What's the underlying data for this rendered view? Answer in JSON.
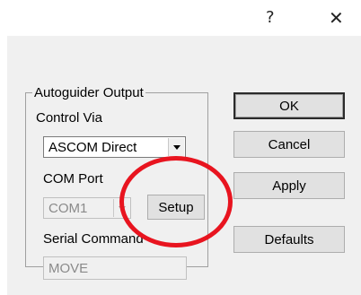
{
  "titlebar": {
    "help_glyph": "?",
    "close_glyph": "✕"
  },
  "group": {
    "legend": "Autoguider Output"
  },
  "control_via": {
    "label": "Control Via",
    "value": "ASCOM Direct"
  },
  "com_port": {
    "label": "COM Port",
    "value": "COM1",
    "setup_label": "Setup"
  },
  "serial_command": {
    "label": "Serial Command",
    "value": "MOVE"
  },
  "buttons": {
    "ok": "OK",
    "cancel": "Cancel",
    "apply": "Apply",
    "defaults": "Defaults"
  },
  "annotation": {
    "circle_color": "#e8141f"
  }
}
